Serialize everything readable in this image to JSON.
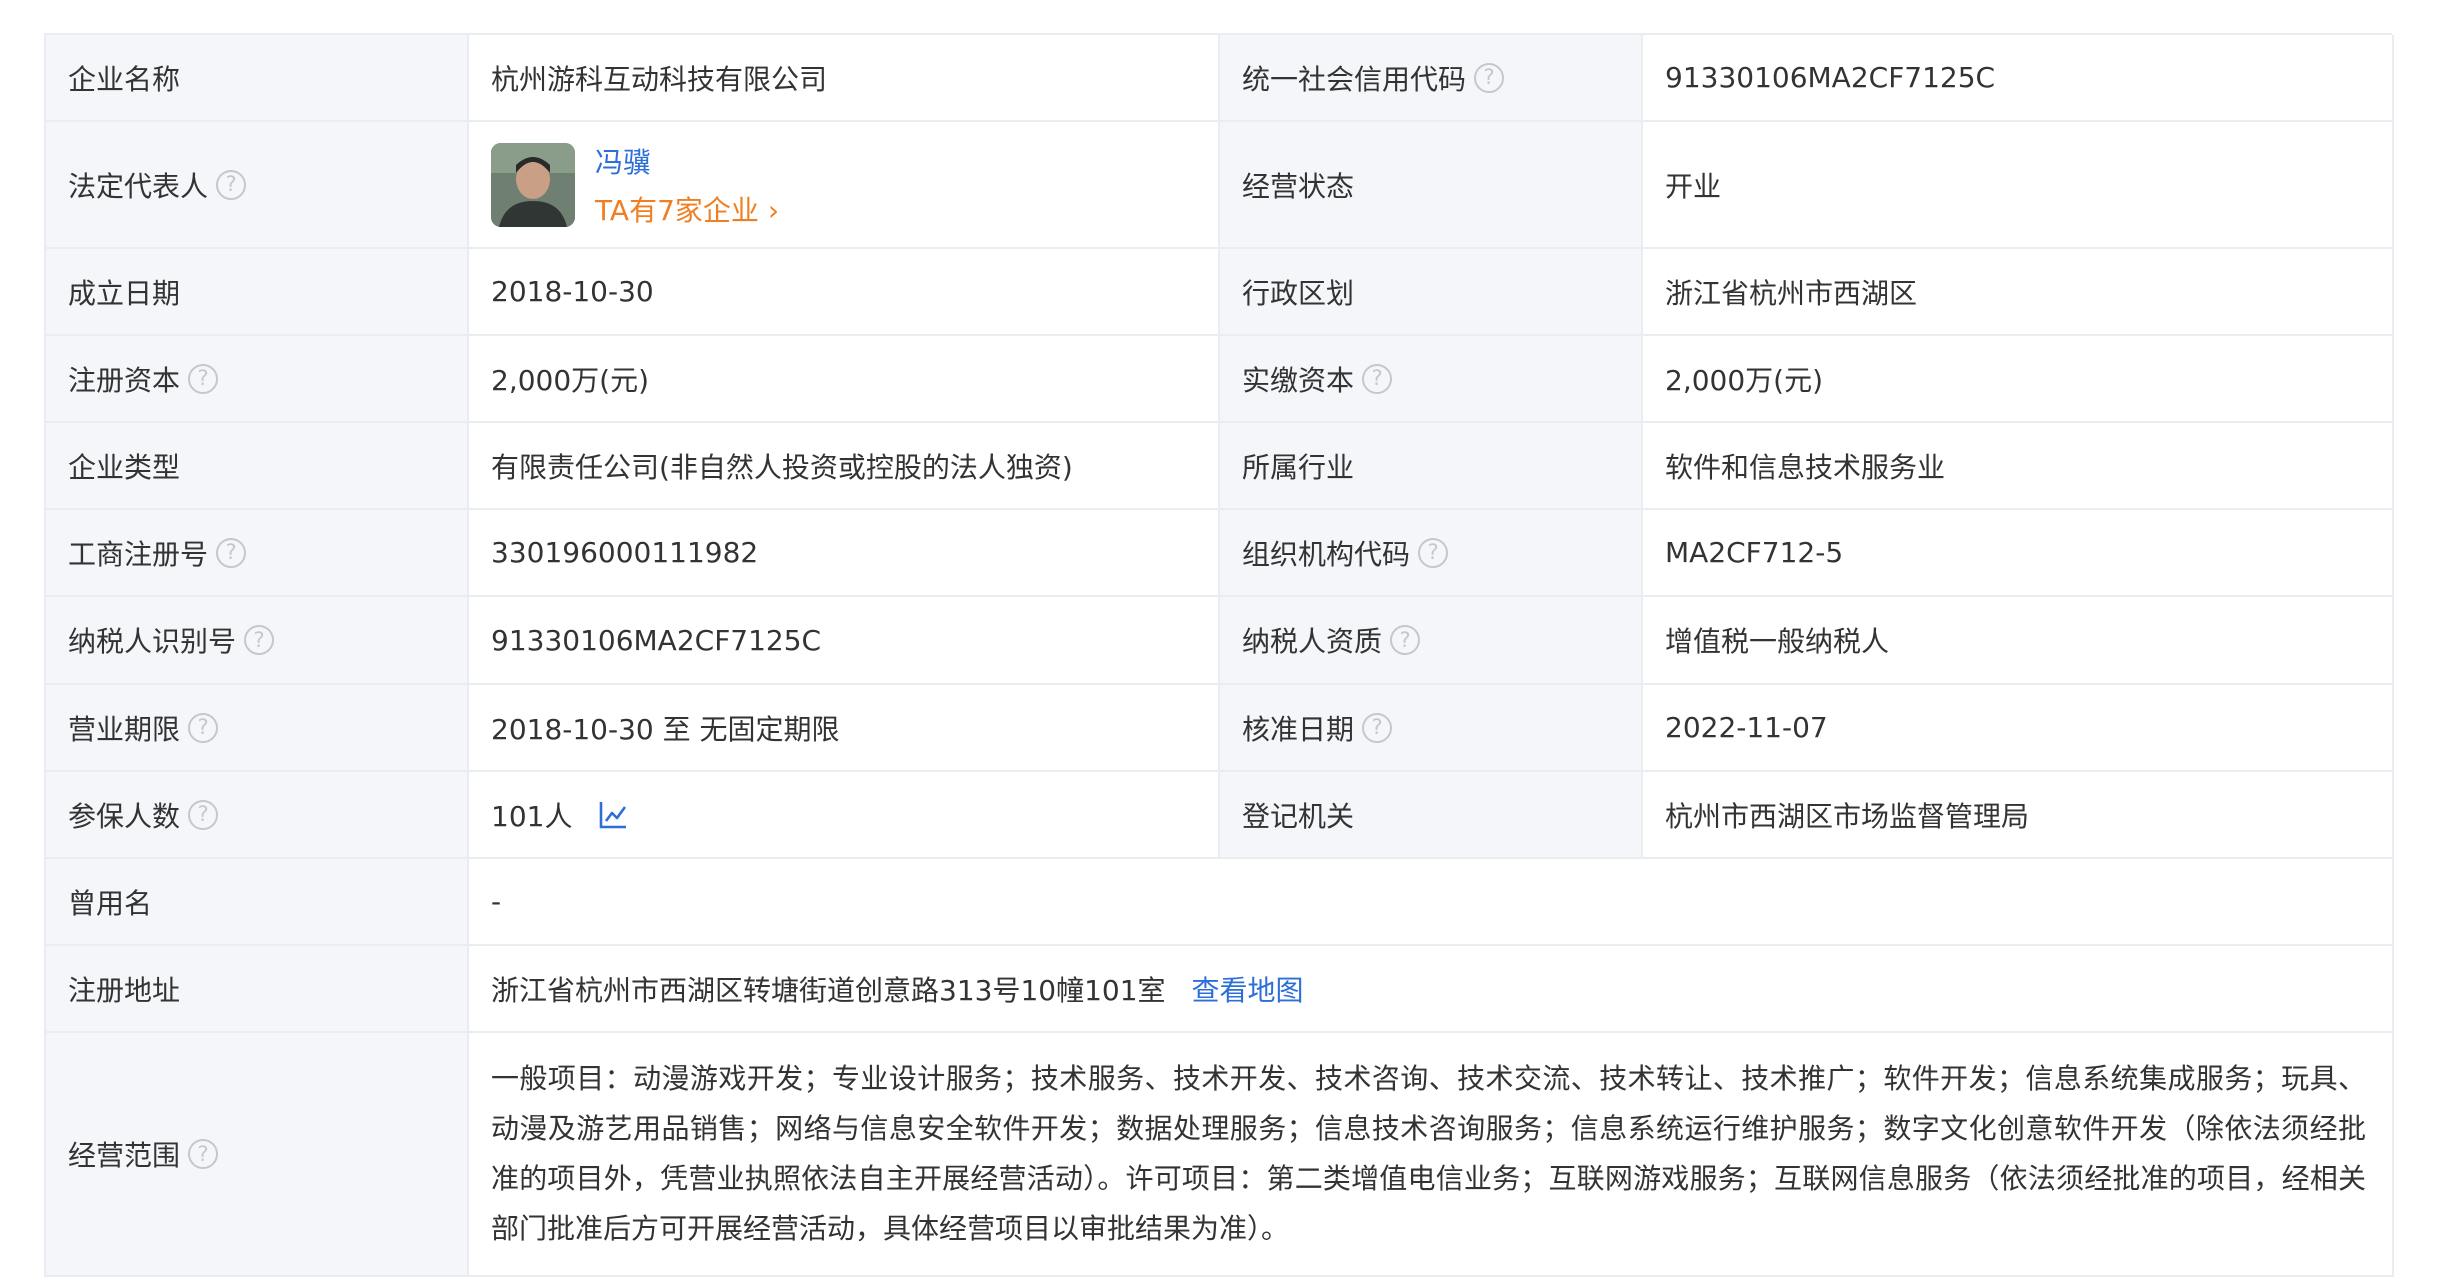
{
  "colors": {
    "label_bg": "#f4f6fa",
    "border": "#e9ecf0",
    "link": "#2d6fd9",
    "accent_orange": "#ef7f22"
  },
  "help_glyph": "?",
  "fields": {
    "company_name": {
      "label": "企业名称",
      "value": "杭州游科互动科技有限公司"
    },
    "credit_code": {
      "label": "统一社会信用代码",
      "value": "91330106MA2CF7125C"
    },
    "legal_rep": {
      "label": "法定代表人",
      "name": "冯骥",
      "more": "TA有7家企业",
      "more_arrow": "›"
    },
    "status": {
      "label": "经营状态",
      "value": "开业"
    },
    "founded": {
      "label": "成立日期",
      "value": "2018-10-30"
    },
    "region": {
      "label": "行政区划",
      "value": "浙江省杭州市西湖区"
    },
    "reg_capital": {
      "label": "注册资本",
      "value": "2,000万(元)"
    },
    "paid_capital": {
      "label": "实缴资本",
      "value": "2,000万(元)"
    },
    "company_type": {
      "label": "企业类型",
      "value": "有限责任公司(非自然人投资或控股的法人独资)"
    },
    "industry": {
      "label": "所属行业",
      "value": "软件和信息技术服务业"
    },
    "biz_reg_no": {
      "label": "工商注册号",
      "value": "330196000111982"
    },
    "org_code": {
      "label": "组织机构代码",
      "value": "MA2CF712-5"
    },
    "taxpayer_id": {
      "label": "纳税人识别号",
      "value": "91330106MA2CF7125C"
    },
    "taxpayer_qual": {
      "label": "纳税人资质",
      "value": "增值税一般纳税人"
    },
    "biz_term": {
      "label": "营业期限",
      "value": "2018-10-30 至 无固定期限"
    },
    "approval_date": {
      "label": "核准日期",
      "value": "2022-11-07"
    },
    "insured": {
      "label": "参保人数",
      "value": "101人"
    },
    "reg_authority": {
      "label": "登记机关",
      "value": "杭州市西湖区市场监督管理局"
    },
    "former_name": {
      "label": "曾用名",
      "value": "-"
    },
    "reg_address": {
      "label": "注册地址",
      "value": "浙江省杭州市西湖区转塘街道创意路313号10幢101室",
      "map_link": "查看地图"
    },
    "biz_scope": {
      "label": "经营范围",
      "value": "一般项目：动漫游戏开发；专业设计服务；技术服务、技术开发、技术咨询、技术交流、技术转让、技术推广；软件开发；信息系统集成服务；玩具、动漫及游艺用品销售；网络与信息安全软件开发；数据处理服务；信息技术咨询服务；信息系统运行维护服务；数字文化创意软件开发（除依法须经批准的项目外，凭营业执照依法自主开展经营活动）。许可项目：第二类增值电信业务；互联网游戏服务；互联网信息服务（依法须经批准的项目，经相关部门批准后方可开展经营活动，具体经营项目以审批结果为准）。"
    }
  }
}
